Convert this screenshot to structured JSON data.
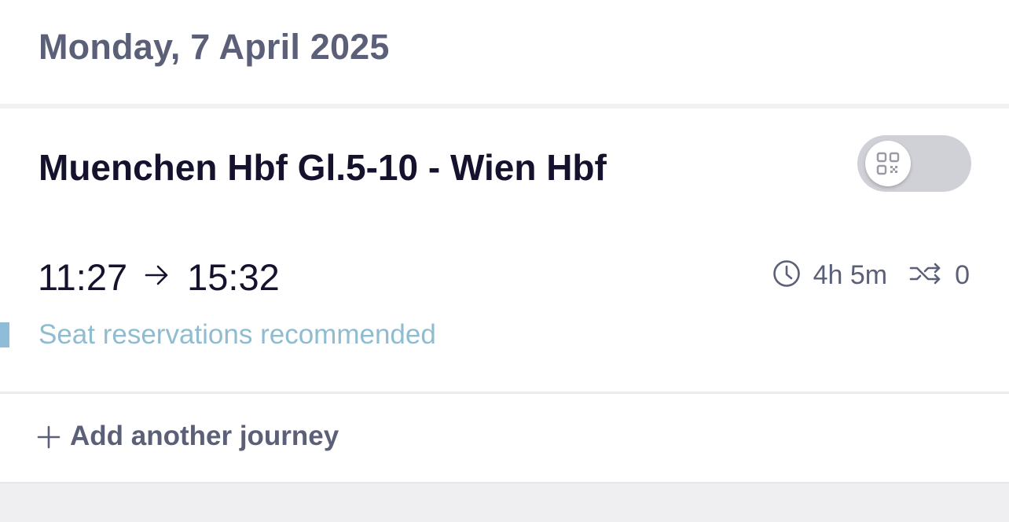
{
  "date_header": {
    "title": "Monday, 7 April 2025"
  },
  "journey": {
    "route": "Muenchen Hbf Gl.5-10 - Wien Hbf",
    "ticket_toggle": {
      "icon": "qr-code-icon",
      "state": "off"
    },
    "departure": "11:27",
    "arrival": "15:32",
    "duration": "4h 5m",
    "changes": "0",
    "notice": "Seat reservations recommended",
    "notice_color": "#8fbcd0"
  },
  "actions": {
    "add_journey_label": "Add another journey"
  },
  "colors": {
    "primary_text": "#15122e",
    "secondary_text": "#5b6078",
    "toggle_track": "#d0d0d7"
  }
}
